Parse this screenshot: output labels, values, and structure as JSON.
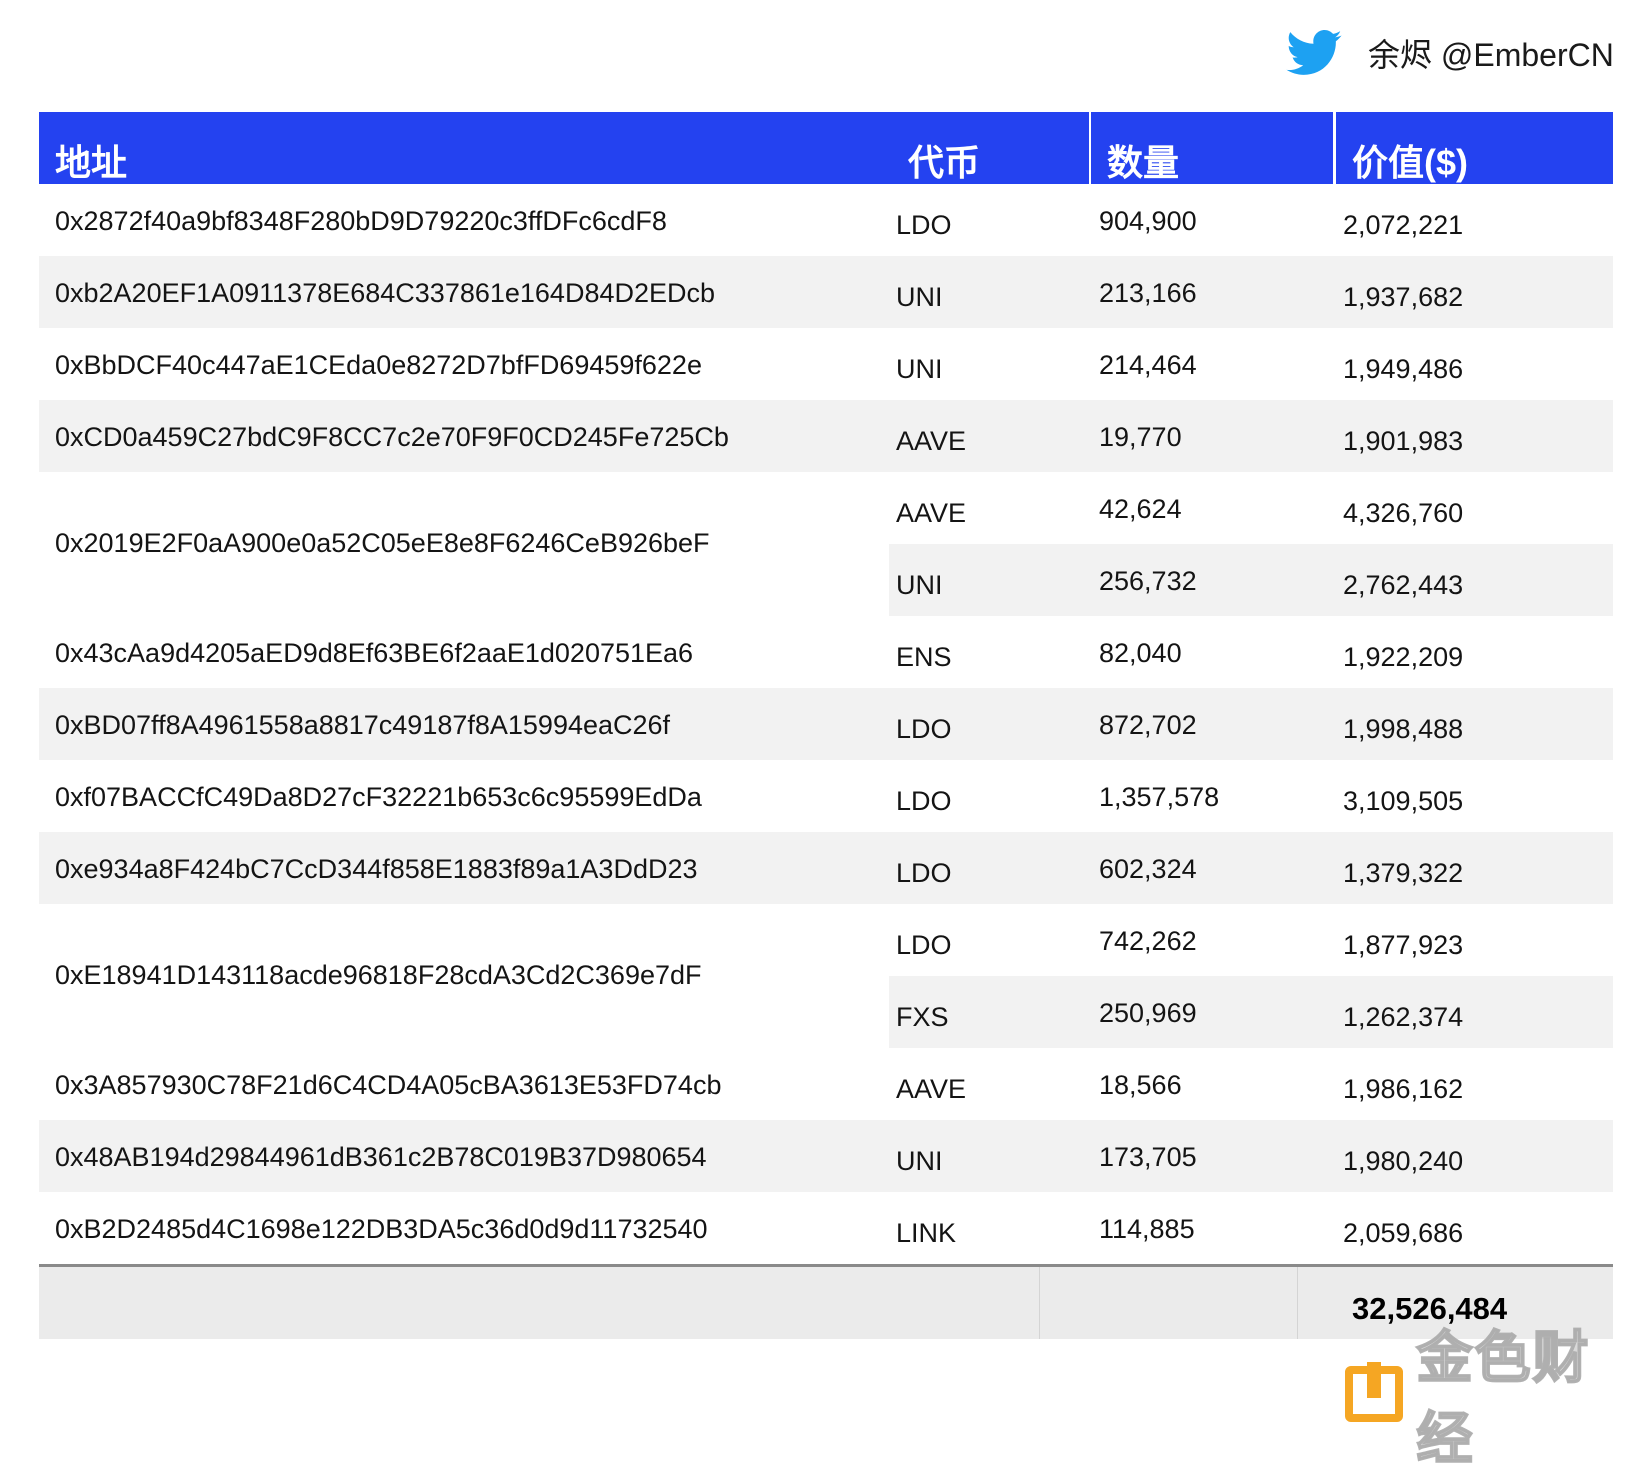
{
  "credit": {
    "text": "余烬 @EmberCN",
    "icon": "twitter-bird-icon",
    "icon_color": "#1da1f2"
  },
  "colors": {
    "header_bg": "#2442f0",
    "header_text": "#ffffff",
    "stripe": "#f2f2f2",
    "total_bg": "#ebebeb"
  },
  "headers": {
    "address": "地址",
    "token": "代币",
    "amount": "数量",
    "value": "价值($)"
  },
  "rows": [
    {
      "address": "0x2872f40a9bf8348F280bD9D79220c3ffDFc6cdF8",
      "holdings": [
        {
          "token": "LDO",
          "amount": "904,900",
          "value": "2,072,221"
        }
      ]
    },
    {
      "address": "0xb2A20EF1A0911378E684C337861e164D84D2EDcb",
      "holdings": [
        {
          "token": "UNI",
          "amount": "213,166",
          "value": "1,937,682"
        }
      ]
    },
    {
      "address": "0xBbDCF40c447aE1CEda0e8272D7bfFD69459f622e",
      "holdings": [
        {
          "token": "UNI",
          "amount": "214,464",
          "value": "1,949,486"
        }
      ]
    },
    {
      "address": "0xCD0a459C27bdC9F8CC7c2e70F9F0CD245Fe725Cb",
      "holdings": [
        {
          "token": "AAVE",
          "amount": "19,770",
          "value": "1,901,983"
        }
      ]
    },
    {
      "address": "0x2019E2F0aA900e0a52C05eE8e8F6246CeB926beF",
      "holdings": [
        {
          "token": "AAVE",
          "amount": "42,624",
          "value": "4,326,760"
        },
        {
          "token": "UNI",
          "amount": "256,732",
          "value": "2,762,443"
        }
      ]
    },
    {
      "address": "0x43cAa9d4205aED9d8Ef63BE6f2aaE1d020751Ea6",
      "holdings": [
        {
          "token": "ENS",
          "amount": "82,040",
          "value": "1,922,209"
        }
      ]
    },
    {
      "address": "0xBD07ff8A4961558a8817c49187f8A15994eaC26f",
      "holdings": [
        {
          "token": "LDO",
          "amount": "872,702",
          "value": "1,998,488"
        }
      ]
    },
    {
      "address": "0xf07BACCfC49Da8D27cF32221b653c6c95599EdDa",
      "holdings": [
        {
          "token": "LDO",
          "amount": "1,357,578",
          "value": "3,109,505"
        }
      ]
    },
    {
      "address": "0xe934a8F424bC7CcD344f858E1883f89a1A3DdD23",
      "holdings": [
        {
          "token": "LDO",
          "amount": "602,324",
          "value": "1,379,322"
        }
      ]
    },
    {
      "address": "0xE18941D143118acde96818F28cdA3Cd2C369e7dF",
      "holdings": [
        {
          "token": "LDO",
          "amount": "742,262",
          "value": "1,877,923"
        },
        {
          "token": "FXS",
          "amount": "250,969",
          "value": "1,262,374"
        }
      ]
    },
    {
      "address": "0x3A857930C78F21d6C4CD4A05cBA3613E53FD74cb",
      "holdings": [
        {
          "token": "AAVE",
          "amount": "18,566",
          "value": "1,986,162"
        }
      ]
    },
    {
      "address": "0x48AB194d29844961dB361c2B78C019B37D980654",
      "holdings": [
        {
          "token": "UNI",
          "amount": "173,705",
          "value": "1,980,240"
        }
      ]
    },
    {
      "address": "0xB2D2485d4C1698e122DB3DA5c36d0d9d11732540",
      "holdings": [
        {
          "token": "LINK",
          "amount": "114,885",
          "value": "2,059,686"
        }
      ]
    }
  ],
  "total": {
    "value": "32,526,484"
  },
  "watermark": {
    "text": "金色财经",
    "icon": "jinse-logo-icon",
    "color": "#f5a623"
  }
}
